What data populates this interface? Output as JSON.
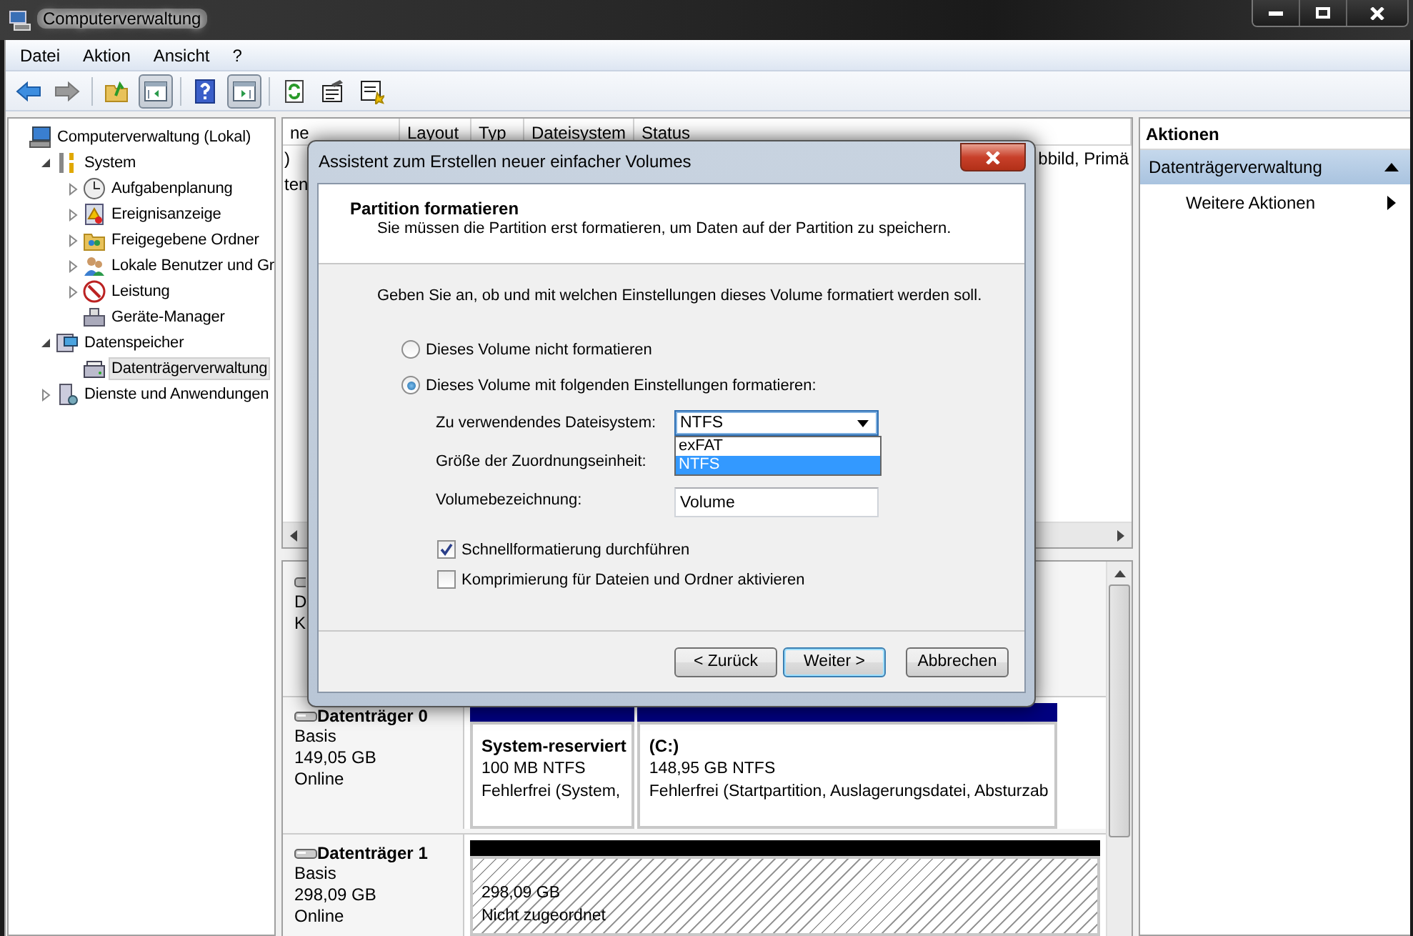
{
  "window": {
    "title": "Computerverwaltung"
  },
  "menu": [
    "Datei",
    "Aktion",
    "Ansicht",
    "?"
  ],
  "toolbar": [
    {
      "kind": "back",
      "pressed": false
    },
    {
      "kind": "forward",
      "pressed": false
    },
    {
      "kind": "separator"
    },
    {
      "kind": "up",
      "pressed": false
    },
    {
      "kind": "tree-pane",
      "pressed": true
    },
    {
      "kind": "separator"
    },
    {
      "kind": "help",
      "pressed": false
    },
    {
      "kind": "action-pane",
      "pressed": true
    },
    {
      "kind": "separator"
    },
    {
      "kind": "refresh",
      "pressed": false
    },
    {
      "kind": "properties",
      "pressed": false
    },
    {
      "kind": "wizard",
      "pressed": false
    }
  ],
  "tree": [
    {
      "label": "Computerverwaltung (Lokal)",
      "kind": "computer",
      "selected": false,
      "children": [
        {
          "label": "System",
          "kind": "tools",
          "selected": false,
          "expanded": true,
          "children": [
            {
              "label": "Aufgabenplanung",
              "kind": "clock",
              "selected": false,
              "expanded": false
            },
            {
              "label": "Ereignisanzeige",
              "kind": "log",
              "selected": false,
              "expanded": false
            },
            {
              "label": "Freigegebene Ordner",
              "kind": "shared",
              "selected": false,
              "expanded": false
            },
            {
              "label": "Lokale Benutzer und Gr",
              "kind": "users",
              "selected": false,
              "expanded": false
            },
            {
              "label": "Leistung",
              "kind": "performance",
              "selected": false,
              "expanded": false
            },
            {
              "label": "Geräte-Manager",
              "kind": "devices",
              "selected": false
            }
          ]
        },
        {
          "label": "Datenspeicher",
          "kind": "storage",
          "selected": false,
          "expanded": true,
          "children": [
            {
              "label": "Datenträgerverwaltung",
              "kind": "disk",
              "selected": true
            }
          ]
        },
        {
          "label": "Dienste und Anwendungen",
          "kind": "services",
          "selected": false,
          "expanded": false
        }
      ]
    }
  ],
  "volume_list": {
    "columns": [
      "ne",
      "Layout",
      "Typ",
      "Dateisystem",
      "Status"
    ],
    "rows": [
      {
        "column_1": ")",
        "status": "bbild, Primä"
      },
      {
        "column_1": "ten"
      }
    ]
  },
  "hidden_disk": [
    "D",
    "K"
  ],
  "disks": [
    {
      "name": "Datenträger 0",
      "type": "Basis",
      "size": "149,05 GB",
      "status": "Online",
      "partitions": [
        {
          "title": "System-reserviert",
          "size": "100 MB NTFS",
          "status": "Fehlerfrei (System,",
          "color": "#000080"
        },
        {
          "title": "(C:)",
          "size": "148,95 GB NTFS",
          "status": "Fehlerfrei (Startpartition, Auslagerungsdatei, Absturzab",
          "color": "#000080"
        }
      ]
    },
    {
      "name": "Datenträger 1",
      "type": "Basis",
      "size": "298,09 GB",
      "status": "Online",
      "partitions": [
        {
          "kind": "unallocated",
          "size": "298,09 GB",
          "status": "Nicht zugeordnet",
          "color": "#000000"
        }
      ]
    }
  ],
  "actions": {
    "title": "Aktionen",
    "sections": [
      {
        "label": "Datenträgerverwaltung",
        "expanded": true,
        "items": [
          "Weitere Aktionen"
        ]
      }
    ]
  },
  "dialog": {
    "title": "Assistent zum Erstellen neuer einfacher Volumes",
    "heading": "Partition formatieren",
    "subheading": "Sie müssen die Partition erst formatieren, um Daten auf der Partition zu speichern.",
    "instruction": "Geben Sie an, ob und mit welchen Einstellungen dieses Volume formatiert werden soll.",
    "radios": [
      {
        "label": "Dieses Volume nicht formatieren",
        "selected": false
      },
      {
        "label": "Dieses Volume mit folgenden Einstellungen formatieren:",
        "selected": true
      }
    ],
    "fields": [
      {
        "kind": "dropdown",
        "label": "Zu verwendendes Dateisystem:",
        "value": "NTFS",
        "expanded": true,
        "options": [
          {
            "label": "exFAT",
            "selected": false
          },
          {
            "label": "NTFS",
            "selected": true
          }
        ]
      },
      {
        "kind": "label",
        "label": "Größe der Zuordnungseinheit:"
      },
      {
        "kind": "text",
        "label": "Volumebezeichnung:",
        "value": "Volume"
      }
    ],
    "checkboxes": [
      {
        "label": "Schnellformatierung durchführen",
        "checked": true
      },
      {
        "label": "Komprimierung für Dateien und Ordner aktivieren",
        "checked": false
      }
    ],
    "buttons": [
      {
        "label": "< Zurück",
        "default": false
      },
      {
        "label": "Weiter >",
        "default": true
      },
      {
        "label": "Abbrechen",
        "default": false
      }
    ]
  }
}
